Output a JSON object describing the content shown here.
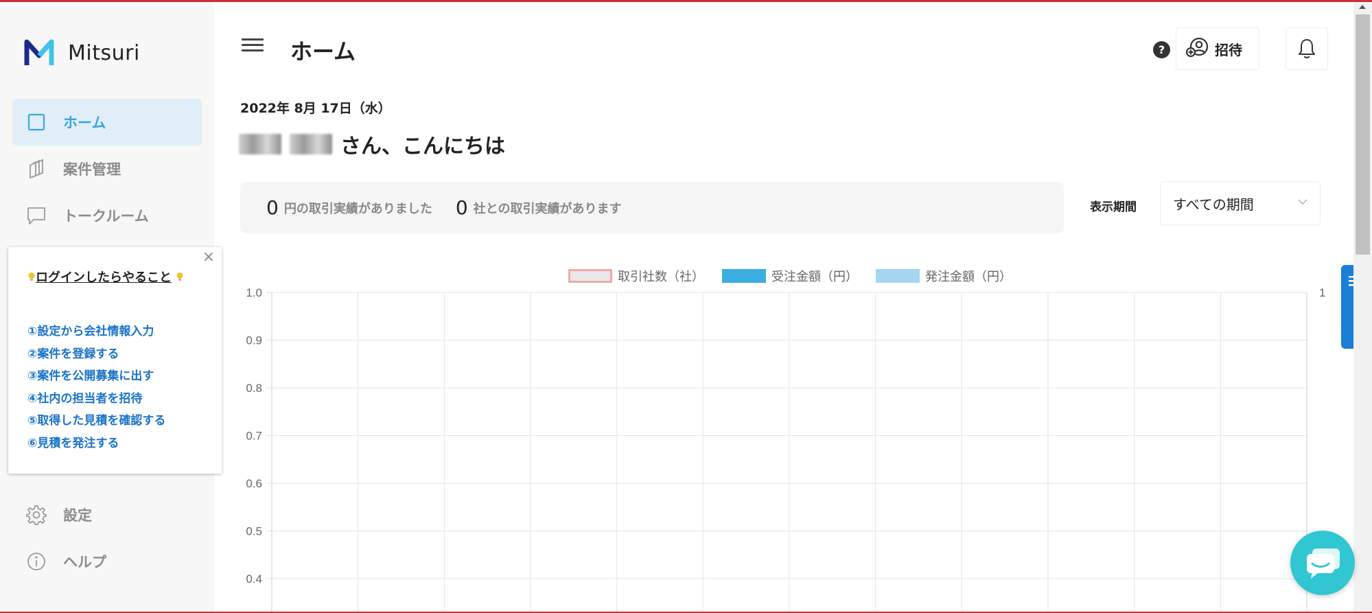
{
  "app": {
    "name": "Mitsuri",
    "brand_colors": [
      "#1b2a8a",
      "#3aa6dd"
    ]
  },
  "sidebar": {
    "items": [
      {
        "label": "ホーム",
        "icon": "home-square-icon",
        "active": true
      },
      {
        "label": "案件管理",
        "icon": "layers-icon",
        "active": false
      },
      {
        "label": "トークルーム",
        "icon": "chat-bubble-icon",
        "active": false
      },
      {
        "label": "設定",
        "icon": "gear-icon",
        "active": false
      },
      {
        "label": "ヘルプ",
        "icon": "info-icon",
        "active": false
      }
    ]
  },
  "popup": {
    "title": "ログインしたらやること",
    "close_icon": "close-icon",
    "steps": [
      "①設定から会社情報入力",
      "②案件を登録する",
      "③案件を公開募集に出す",
      "④社内の担当者を招待",
      "⑤取得した見積を確認する",
      "⑥見積を発注する"
    ]
  },
  "header": {
    "title": "ホーム",
    "help_label": "?",
    "invite_label": "招待"
  },
  "main": {
    "date": "2022年 8月 17日（水）",
    "greeting_suffix": "さん、こんにちは",
    "stats": {
      "amount_value": "0",
      "amount_label": "円の取引実績がありました",
      "companies_value": "0",
      "companies_label": "社との取引実績があります"
    },
    "period": {
      "label": "表示期間",
      "value": "すべての期間"
    }
  },
  "guide": {
    "label": "ガイド"
  },
  "chart_data": {
    "type": "bar",
    "series": [
      {
        "name": "取引社数（社）",
        "values": [],
        "color": "#e8e8e8",
        "border": "#f0a9a5"
      },
      {
        "name": "受注金額（円）",
        "values": [],
        "color": "#3aaee0"
      },
      {
        "name": "発注金額（円）",
        "values": [],
        "color": "#a4d6f0"
      }
    ],
    "y_ticks": [
      "1.0",
      "0.9",
      "0.8",
      "0.7",
      "0.6",
      "0.5",
      "0.4"
    ],
    "y_right_top_label": "1",
    "ylim": [
      0,
      1
    ],
    "grid": true,
    "legend_position": "top"
  }
}
